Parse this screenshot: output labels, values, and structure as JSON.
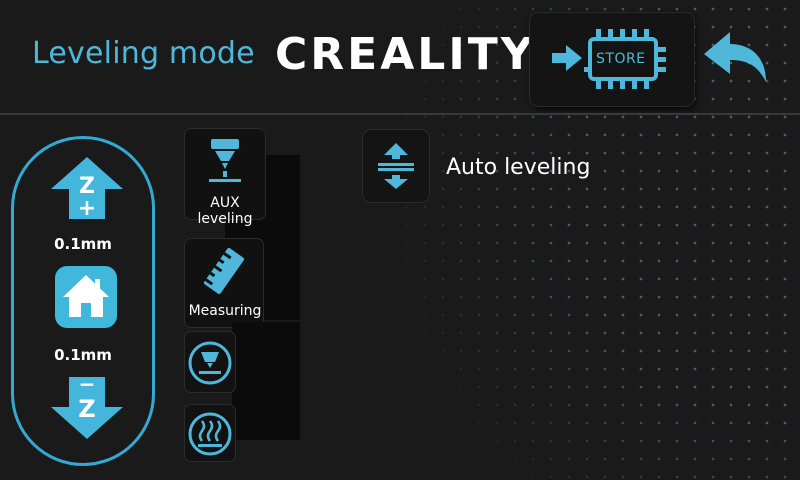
{
  "header": {
    "title": "Leveling mode",
    "brand": "CREALITY",
    "store_label": "STORE"
  },
  "z_controls": {
    "up_label": "Z",
    "up_sign": "+",
    "down_label": "Z",
    "down_sign": "−",
    "step_top": "0.1mm",
    "step_bottom": "0.1mm"
  },
  "tools": {
    "aux_leveling": "AUX leveling",
    "measuring": "Measuring"
  },
  "auto": {
    "label": "Auto leveling"
  },
  "colors": {
    "accent": "#34a9d4",
    "background": "#1a1a1a",
    "title": "#4fb8da"
  },
  "icons": [
    "store-icon",
    "back-arrow-icon",
    "z-up-icon",
    "z-down-icon",
    "home-icon",
    "nozzle-icon",
    "ruler-icon",
    "nozzle-temp-icon",
    "heatbed-icon",
    "auto-leveling-icon"
  ]
}
